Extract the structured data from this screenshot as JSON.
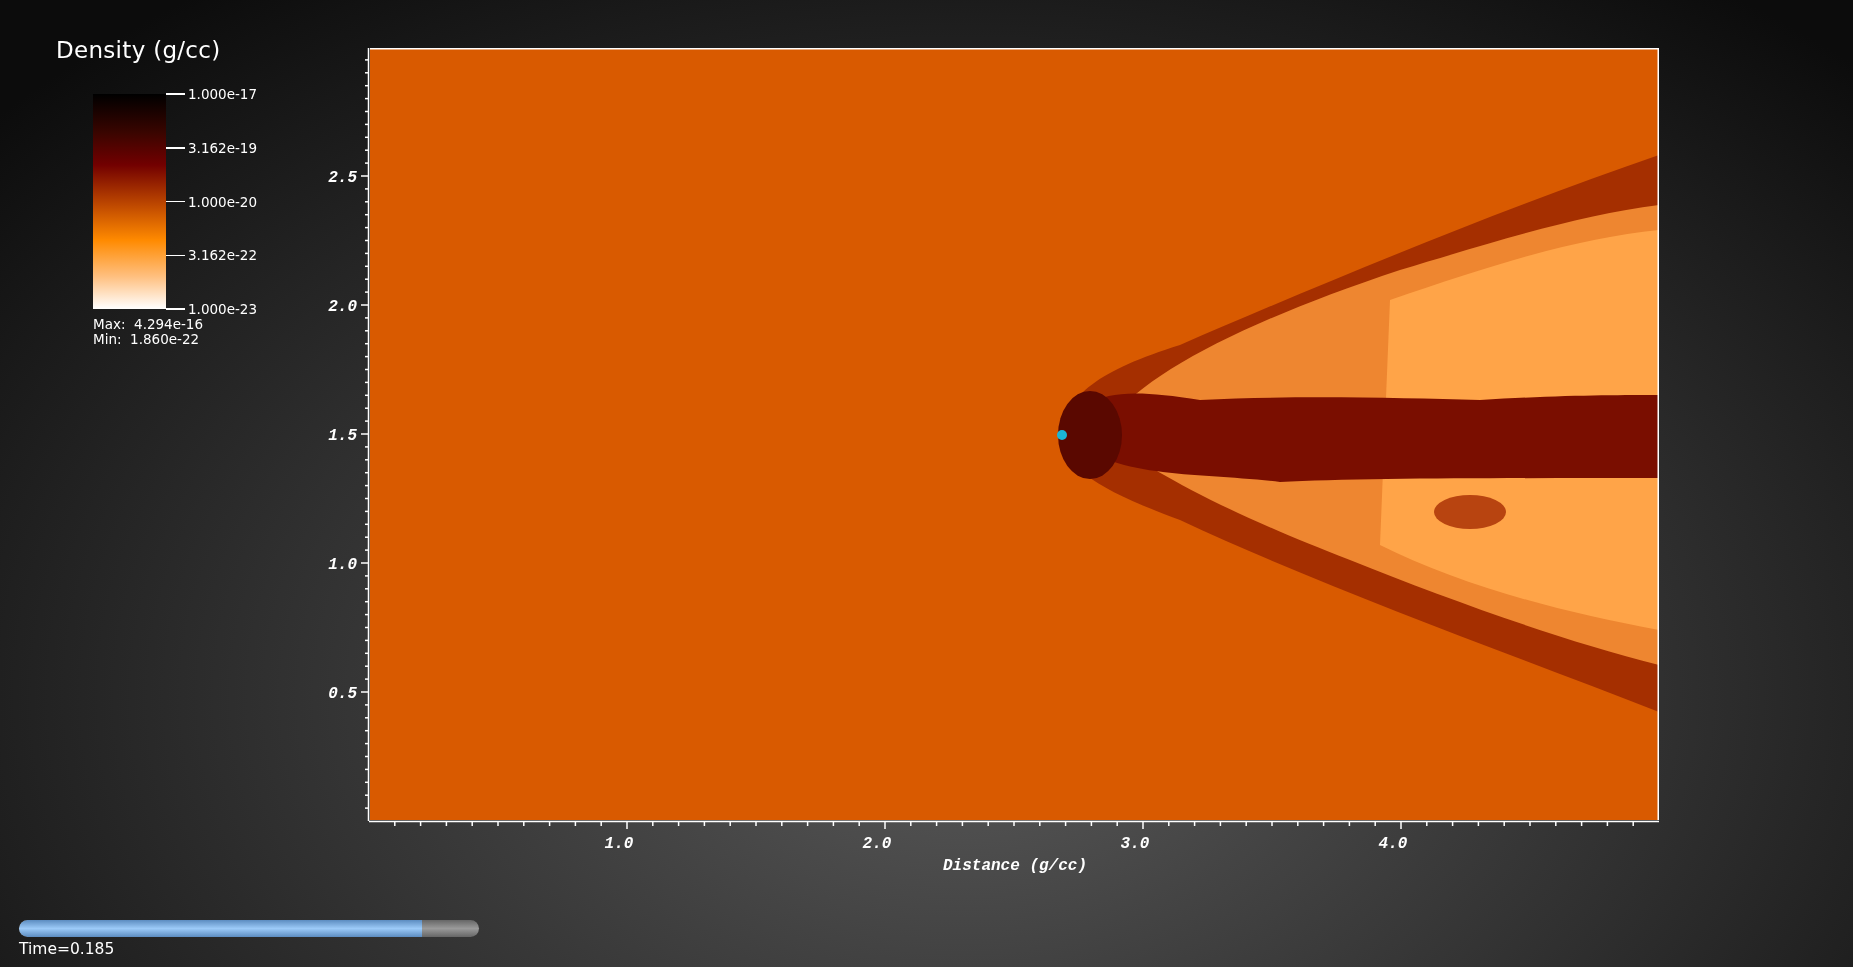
{
  "legend": {
    "title": "Density (g/cc)",
    "ticks": [
      "1.000e-17",
      "3.162e-19",
      "1.000e-20",
      "3.162e-22",
      "1.000e-23"
    ],
    "max": "Max:  4.294e-16",
    "min": "Min:  1.860e-22"
  },
  "plot": {
    "y_ticks": [
      "2.5",
      "2.0",
      "1.5",
      "1.0",
      "0.5"
    ],
    "x_ticks": [
      "1.0",
      "2.0",
      "3.0",
      "4.0"
    ],
    "xlabel": "Distance (g/cc)"
  },
  "time_slider": {
    "level": 0.875,
    "label": "Time=0.185"
  }
}
